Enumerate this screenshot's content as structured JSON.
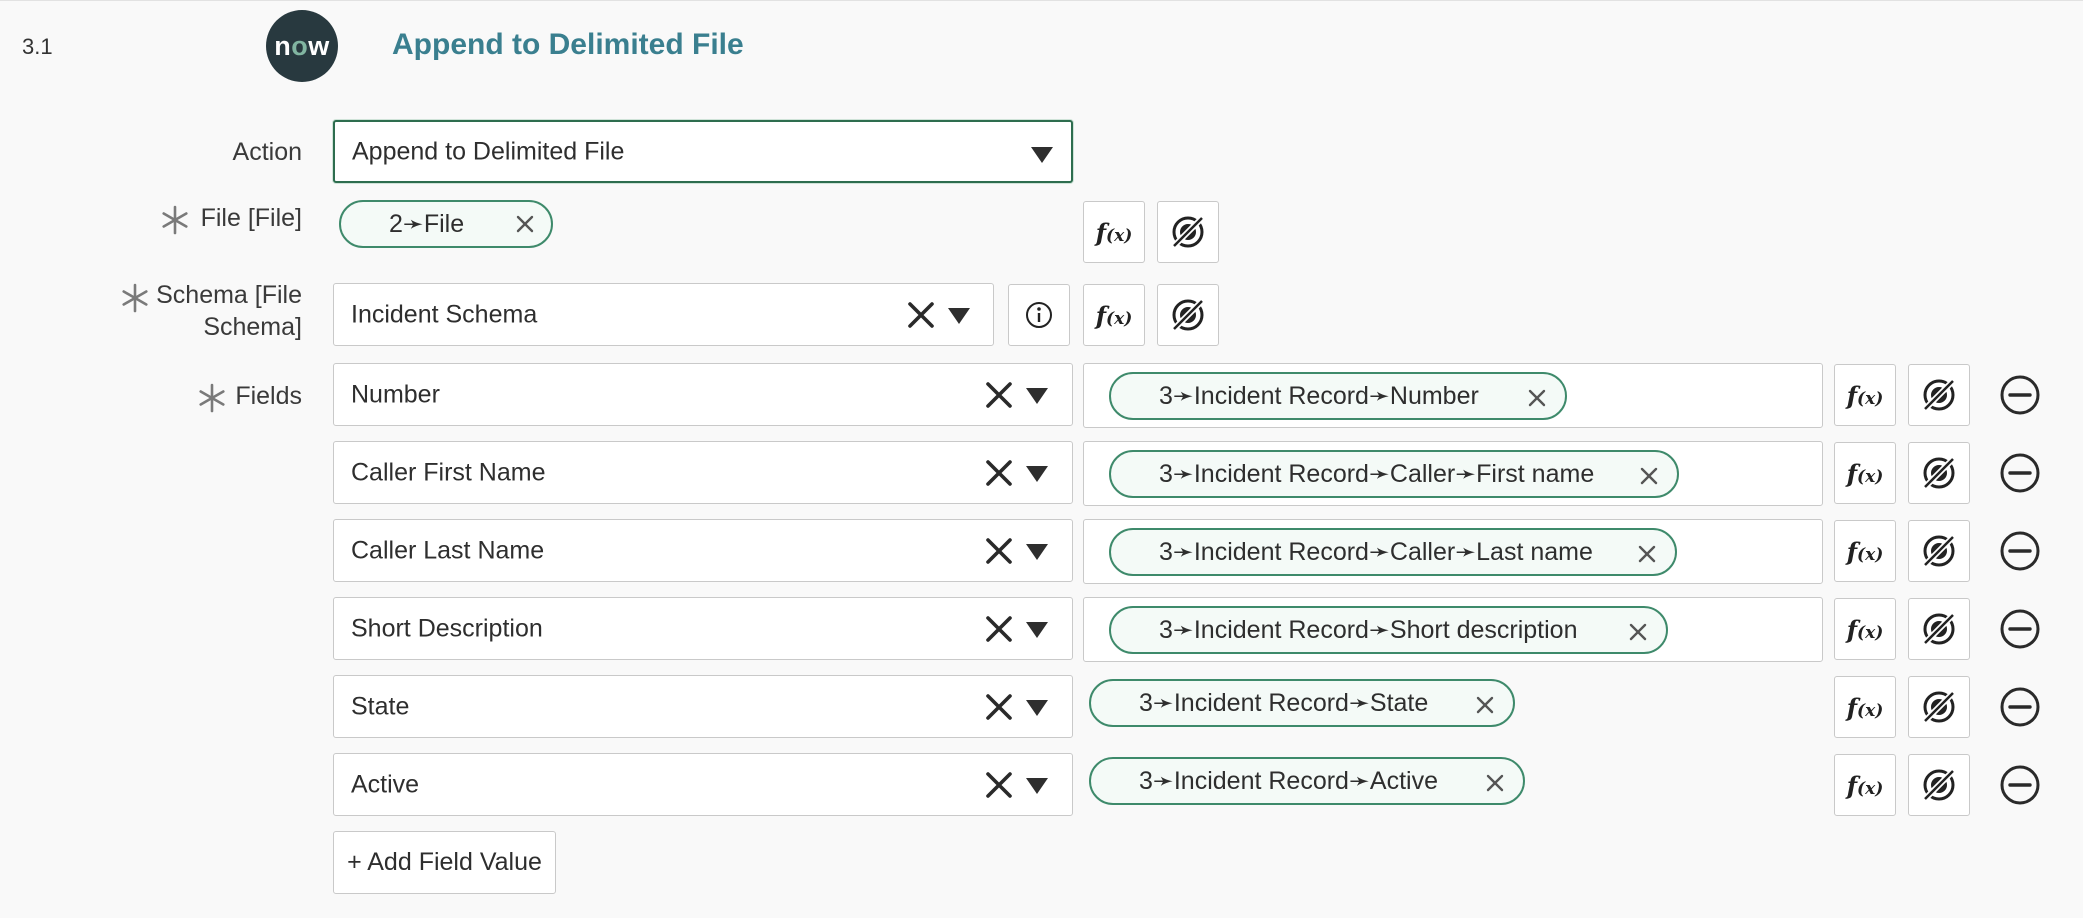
{
  "step": {
    "number": "3.1",
    "logo_text_n": "n",
    "logo_text_o": "o",
    "logo_text_w": "w",
    "title": "Append to Delimited File"
  },
  "action": {
    "label": "Action",
    "value": "Append to Delimited File"
  },
  "file_input": {
    "label": "File [File]",
    "pill": "2➛File"
  },
  "schema": {
    "label_line1": "Schema [File",
    "label_line2": "Schema]",
    "value": "Incident Schema"
  },
  "fields": {
    "label": "Fields",
    "rows": [
      {
        "name": "Number",
        "value": "3➛Incident Record➛Number"
      },
      {
        "name": "Caller First Name",
        "value": "3➛Incident Record➛Caller➛First name"
      },
      {
        "name": "Caller Last Name",
        "value": "3➛Incident Record➛Caller➛Last name"
      },
      {
        "name": "Short Description",
        "value": "3➛Incident Record➛Short description"
      },
      {
        "name": "State",
        "value": "3➛Incident Record➛State"
      },
      {
        "name": "Active",
        "value": "3➛Incident Record➛Active"
      }
    ],
    "add_button": "+ Add Field Value"
  },
  "icons": {
    "required": "asterisk-icon",
    "function": "function-fx-icon",
    "data_pill": "data-pill-picker-icon",
    "info": "info-icon",
    "remove": "remove-circle-icon",
    "clear": "close-icon",
    "dropdown": "caret-down-icon"
  },
  "colors": {
    "title": "#3a7f8f",
    "pill_border": "#3e8a6b",
    "logo_bg": "#28393f",
    "logo_accent": "#81b5a1"
  },
  "fx_f": "f",
  "fx_x": "(x)"
}
